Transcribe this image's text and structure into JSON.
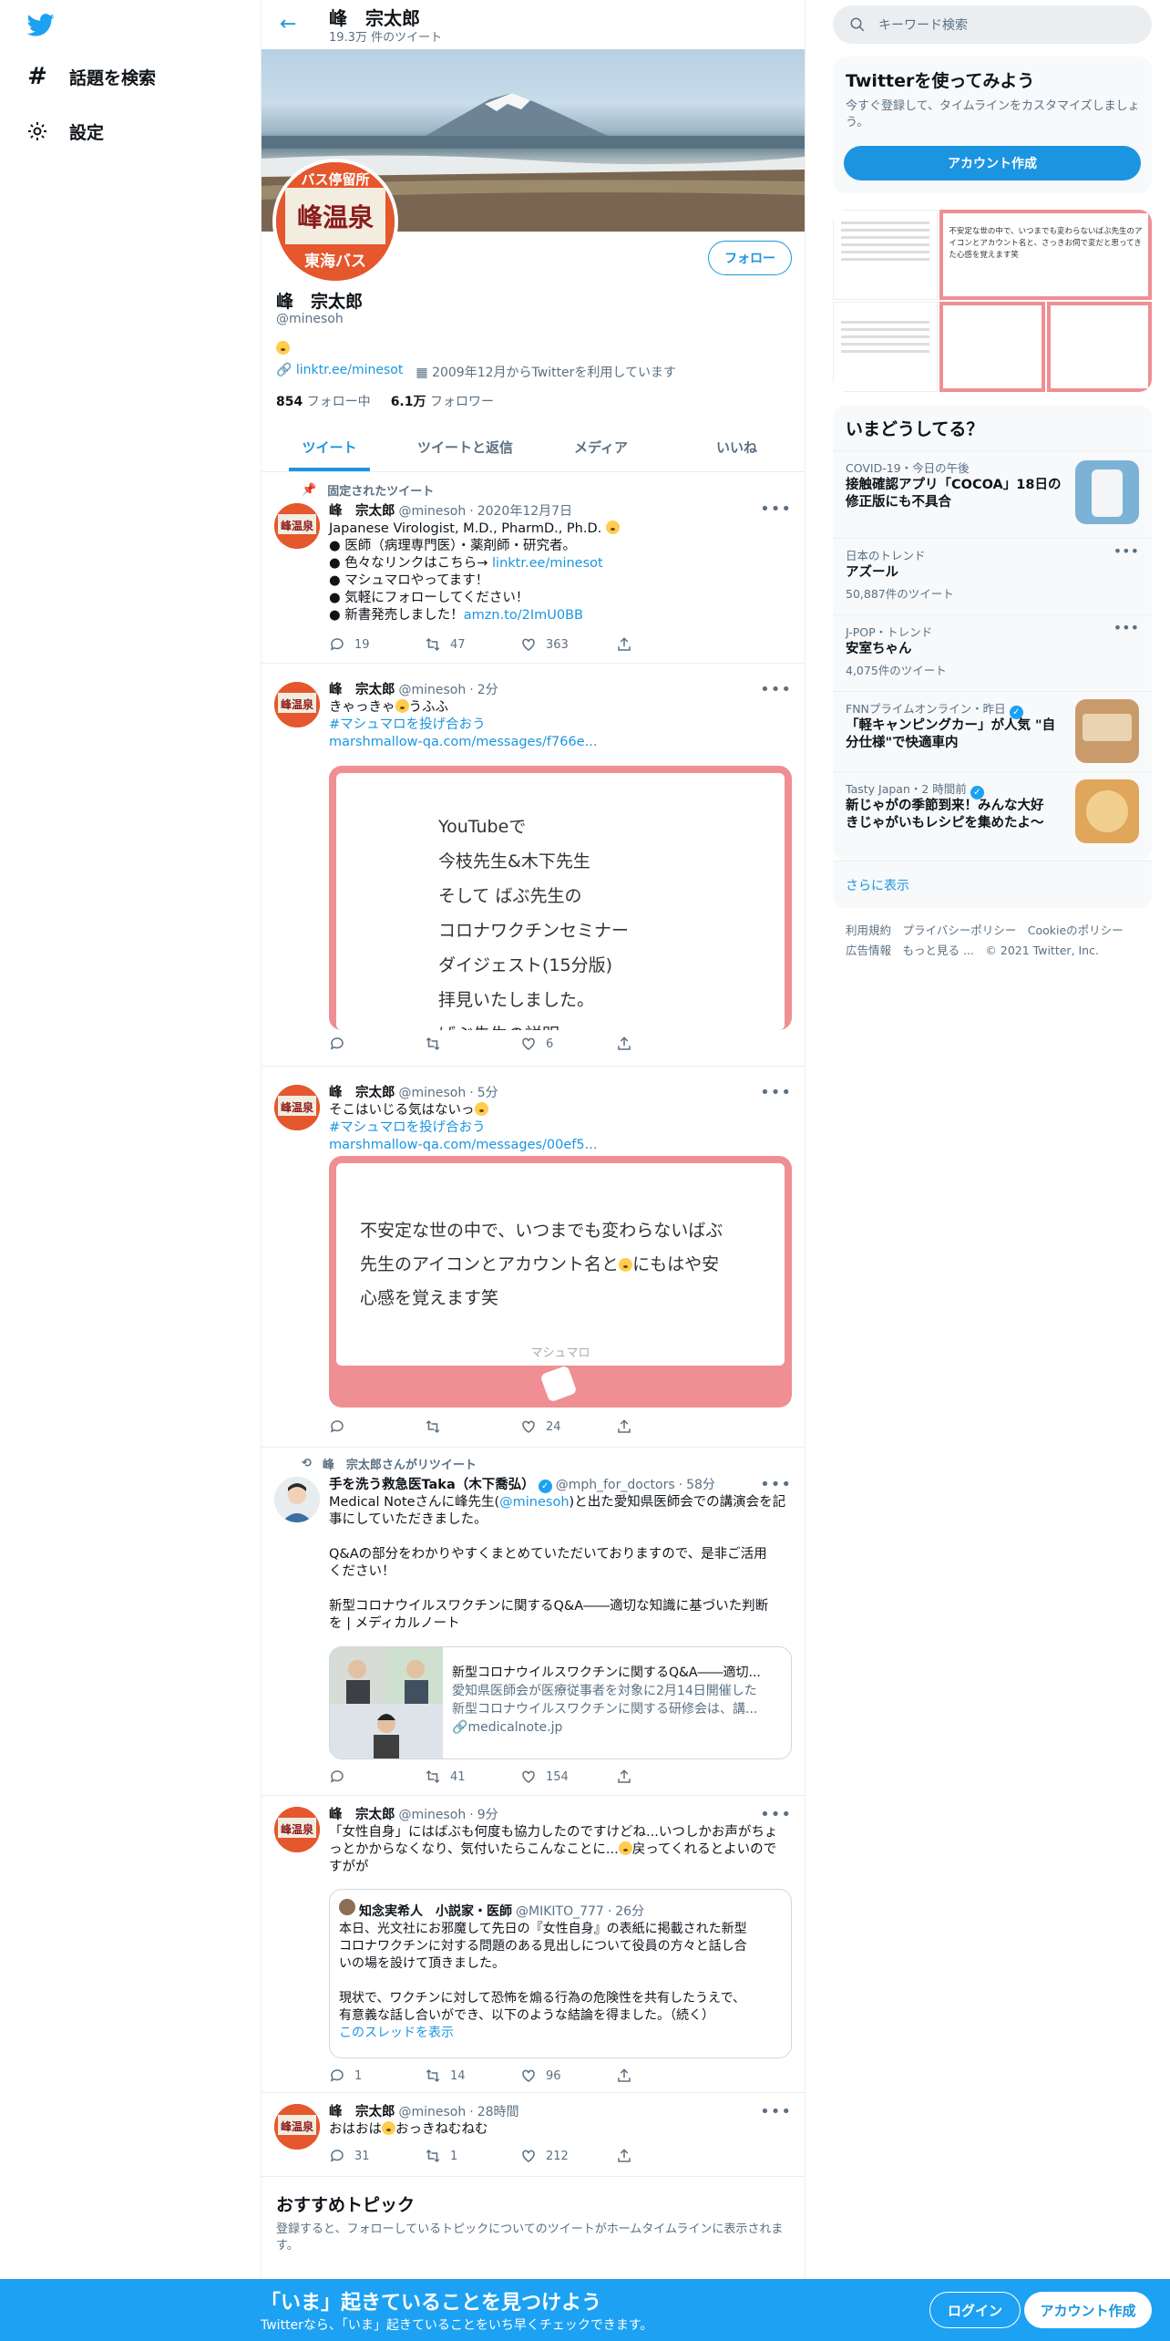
{
  "nav": {
    "items": [
      {
        "label": "話題を検索",
        "icon": "hash-icon"
      },
      {
        "label": "設定",
        "icon": "gear-icon"
      }
    ]
  },
  "header": {
    "name": "峰　宗太郎",
    "tweet_count": "19.3万 件のツイート"
  },
  "profile": {
    "name": "峰　宗太郎",
    "handle": "@minesoh",
    "follow_label": "フォロー",
    "link": "linktr.ee/minesot",
    "joined": "2009年12月からTwitterを利用しています",
    "following_count": "854",
    "following_label": "フォロー中",
    "followers_count": "6.1万",
    "followers_label": "フォロワー",
    "avatar_text_top": "バス停留所",
    "avatar_text_main": "峰温泉",
    "avatar_text_bottom": "東海バス"
  },
  "tabs": [
    "ツイート",
    "ツイートと返信",
    "メディア",
    "いいね"
  ],
  "tweets": [
    {
      "context": "固定されたツイート",
      "name": "峰　宗太郎",
      "handle": "@minesoh",
      "date": "2020年12月7日",
      "lines": [
        "Japanese Virologist, M.D., PharmD., Ph.D.",
        "● 医師（病理専門医）・薬剤師・研究者。",
        "● 色々なリンクはこちら→",
        "● マシュマロやってます！",
        "● 気軽にフォローしてください！",
        "● 新書発売しました！"
      ],
      "link1": "linktr.ee/minesot",
      "link2": "amzn.to/2ImU0BB",
      "reply": "19",
      "retweet": "47",
      "like": "363"
    },
    {
      "name": "峰　宗太郎",
      "handle": "@minesoh",
      "date": "2分",
      "text": "きゃっきゃ",
      "text_tail": "うふふ",
      "hashtag": "#マシュマロを投げ合おう",
      "url": "marshmallow-qa.com/messages/f766e...",
      "card_lines": [
        "YouTubeで",
        "今枝先生&木下先生",
        "そして ばぶ先生の",
        "コロナワクチンセミナー",
        "ダイジェスト(15分版)",
        "拝見いたしました。",
        "ばぶ先生の説明"
      ],
      "reply": "",
      "retweet": "",
      "like": "6"
    },
    {
      "name": "峰　宗太郎",
      "handle": "@minesoh",
      "date": "5分",
      "text": "そこはいじる気はないっ",
      "hashtag": "#マシュマロを投げ合おう",
      "url": "marshmallow-qa.com/messages/00ef5...",
      "card_lines": [
        "不安定な世の中で、いつまでも変わらないばぶ",
        "先生のアイコンとアカウント名と",
        "にもはや安",
        "心感を覚えます笑"
      ],
      "card_footer": "マシュマロ",
      "reply": "",
      "retweet": "",
      "like": "24"
    },
    {
      "context": "峰　宗太郎さんがリツイート",
      "name": "手を洗う救急医Taka（木下喬弘）",
      "handle": "@mph_for_doctors",
      "date": "58分",
      "line1a": "Medical Noteさんに峰先生(",
      "mention": "@minesoh",
      "line1b": ")と出た愛知県医師会での講演会を記",
      "line2": "事にしていただきました。",
      "line3": "Q&Aの部分をわかりやすくまとめていただいておりますので、是非ご活用",
      "line4": "ください！",
      "line5": "新型コロナウイルスワクチンに関するQ&A――適切な知識に基づいた判断",
      "line6": "を | メディカルノート",
      "card_title": "新型コロナウイルスワクチンに関するQ&A――適切...",
      "card_desc1": "愛知県医師会が医療従事者を対象に2月14日開催した",
      "card_desc2": "新型コロナウイルスワクチンに関する研修会は、講...",
      "card_domain": "medicalnote.jp",
      "reply": "",
      "retweet": "41",
      "like": "154"
    },
    {
      "name": "峰　宗太郎",
      "handle": "@minesoh",
      "date": "9分",
      "line1": "「女性自身」にはばぶも何度も協力したのですけどね...いつしかお声がちょ",
      "line2": "っとかからなくなり、気付いたらこんなことに...",
      "line2b": "戻ってくれるとよいので",
      "line3": "すがが",
      "quote_name": "知念実希人　小説家・医師",
      "quote_handle": "@MIKITO_777",
      "quote_date": "26分",
      "quote_l1": "本日、光文社にお邪魔して先日の『女性自身』の表紙に掲載された新型",
      "quote_l2": "コロナワクチンに対する問題のある見出しについて役員の方々と話し合",
      "quote_l3": "いの場を設けて頂きました。",
      "quote_l4": "現状で、ワクチンに対して恐怖を煽る行為の危険性を共有したうえで、",
      "quote_l5": "有意義な話し合いができ、以下のような結論を得ました。（続く）",
      "quote_thread": "このスレッドを表示",
      "reply": "1",
      "retweet": "14",
      "like": "96"
    },
    {
      "name": "峰　宗太郎",
      "handle": "@minesoh",
      "date": "28時間",
      "text_a": "おはおは",
      "text_b": "おっきねむねむ",
      "reply": "31",
      "retweet": "1",
      "like": "212"
    }
  ],
  "recommend": {
    "title": "おすすめトピック",
    "desc1": "登録すると、フォローしているトピックについてのツイートがホームタイムラインに表示されま",
    "desc2": "す。"
  },
  "right": {
    "search_placeholder": "キーワード検索",
    "signup_title": "Twitterを使ってみよう",
    "signup_desc1": "今すぐ登録して、タイムラインをカスタマイズしましょ",
    "signup_desc2": "う。",
    "signup_button": "アカウント作成",
    "media_caption": "不安定な世の中で、いつまでも変わらないばぶ先生のアイコンとアカウント名と、さっきお伺で変だと思ってきた心感を覚えます笑",
    "trends_title": "いまどうしてる？",
    "trends": [
      {
        "meta": "COVID-19・今日の午後",
        "title1": "接触確認アプリ「COCOA」18日の",
        "title2": "修正版にも不具合",
        "count": ""
      },
      {
        "meta": "日本のトレンド",
        "title1": "アズール",
        "title2": "",
        "count": "50,887件のツイート"
      },
      {
        "meta": "J-POP・トレンド",
        "title1": "安室ちゃん",
        "title2": "",
        "count": "4,075件のツイート"
      },
      {
        "meta": "FNNプライムオンライン・昨日",
        "title1": "「軽キャンピングカー」が人気 \"自",
        "title2": "分仕様\"で快適車内",
        "count": ""
      },
      {
        "meta": "Tasty Japan・2 時間前",
        "title1": "新じゃがの季節到来！みんな大好",
        "title2": "きじゃがいもレシピを集めたよ〜",
        "count": ""
      }
    ],
    "show_more": "さらに表示",
    "footer1": "利用規約　プライバシーポリシー　Cookieのポリシー",
    "footer2": "広告情報　もっと見る ...　© 2021 Twitter, Inc."
  },
  "bottom": {
    "headline": "「いま」起きていることを見つけよう",
    "sub": "Twitterなら、「いま」起きていることをいち早くチェックできます。",
    "login": "ログイン",
    "signup": "アカウント作成"
  },
  "colors": {
    "accent": "#1b95e0",
    "banner_bar": "#1da1f2",
    "marshmallow": "#ef8f93"
  }
}
